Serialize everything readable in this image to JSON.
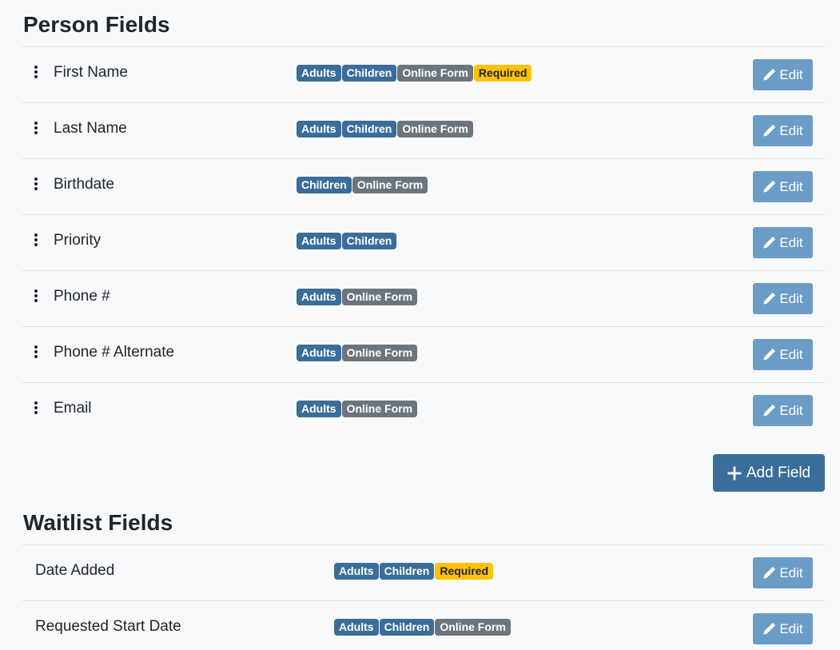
{
  "person_section": {
    "title": "Person Fields",
    "rows": [
      {
        "name": "First Name",
        "badges": [
          {
            "label": "Adults",
            "kind": "adults"
          },
          {
            "label": "Children",
            "kind": "children"
          },
          {
            "label": "Online Form",
            "kind": "online"
          },
          {
            "label": "Required",
            "kind": "required"
          }
        ],
        "edit_label": "Edit"
      },
      {
        "name": "Last Name",
        "badges": [
          {
            "label": "Adults",
            "kind": "adults"
          },
          {
            "label": "Children",
            "kind": "children"
          },
          {
            "label": "Online Form",
            "kind": "online"
          }
        ],
        "edit_label": "Edit"
      },
      {
        "name": "Birthdate",
        "badges": [
          {
            "label": "Children",
            "kind": "children"
          },
          {
            "label": "Online Form",
            "kind": "online"
          }
        ],
        "edit_label": "Edit"
      },
      {
        "name": "Priority",
        "badges": [
          {
            "label": "Adults",
            "kind": "adults"
          },
          {
            "label": "Children",
            "kind": "children"
          }
        ],
        "edit_label": "Edit"
      },
      {
        "name": "Phone #",
        "badges": [
          {
            "label": "Adults",
            "kind": "adults"
          },
          {
            "label": "Online Form",
            "kind": "online"
          }
        ],
        "edit_label": "Edit"
      },
      {
        "name": "Phone # Alternate",
        "badges": [
          {
            "label": "Adults",
            "kind": "adults"
          },
          {
            "label": "Online Form",
            "kind": "online"
          }
        ],
        "edit_label": "Edit"
      },
      {
        "name": "Email",
        "badges": [
          {
            "label": "Adults",
            "kind": "adults"
          },
          {
            "label": "Online Form",
            "kind": "online"
          }
        ],
        "edit_label": "Edit"
      }
    ],
    "add_label": "Add Field"
  },
  "waitlist_section": {
    "title": "Waitlist Fields",
    "rows": [
      {
        "name": "Date Added",
        "badges": [
          {
            "label": "Adults",
            "kind": "adults"
          },
          {
            "label": "Children",
            "kind": "children"
          },
          {
            "label": "Required",
            "kind": "required"
          }
        ],
        "edit_label": "Edit"
      },
      {
        "name": "Requested Start Date",
        "badges": [
          {
            "label": "Adults",
            "kind": "adults"
          },
          {
            "label": "Children",
            "kind": "children"
          },
          {
            "label": "Online Form",
            "kind": "online"
          }
        ],
        "edit_label": "Edit"
      }
    ]
  },
  "colors": {
    "primary": "#3a6d99",
    "edit_button": "#6b9cc6",
    "online_badge": "#6c757d",
    "required_badge": "#ffc107",
    "background": "#f8f9fb"
  },
  "icons": {
    "drag": "vertical-ellipsis-icon",
    "edit": "pencil-icon",
    "add": "plus-icon"
  }
}
